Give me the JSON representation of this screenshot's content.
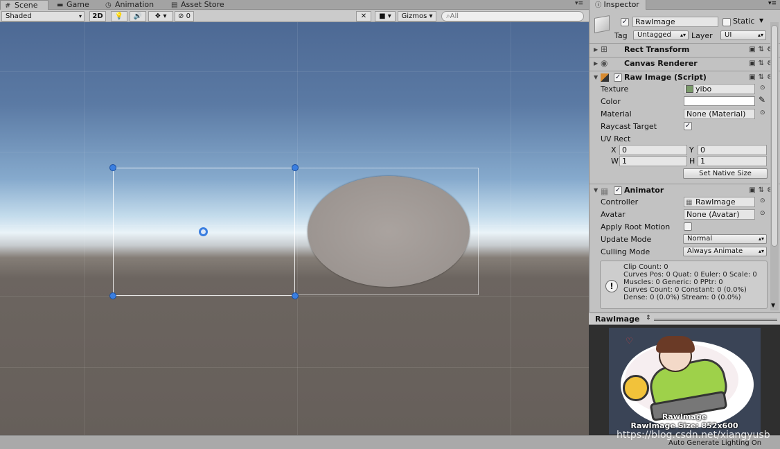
{
  "tabs": [
    {
      "label": "Scene",
      "icon": "grid-icon"
    },
    {
      "label": "Game",
      "icon": "gamepad-icon"
    },
    {
      "label": "Animation",
      "icon": "clock-icon"
    },
    {
      "label": "Asset Store",
      "icon": "store-icon"
    }
  ],
  "toolbar": {
    "shading": "Shaded",
    "mode_2d": "2D",
    "hidden_count": "0",
    "gizmos": "Gizmos",
    "search_placeholder": "All"
  },
  "inspector": {
    "tab": "Inspector",
    "object_name": "RawImage",
    "static_label": "Static",
    "tag_label": "Tag",
    "tag_value": "Untagged",
    "layer_label": "Layer",
    "layer_value": "UI",
    "components": {
      "rect_transform": "Rect Transform",
      "canvas_renderer": "Canvas Renderer",
      "raw_image": "Raw Image (Script)",
      "animator": "Animator"
    },
    "raw_image": {
      "texture_label": "Texture",
      "texture_value": "yibo",
      "color_label": "Color",
      "material_label": "Material",
      "material_value": "None (Material)",
      "raycast_label": "Raycast Target",
      "uv_label": "UV Rect",
      "x_label": "X",
      "x_value": "0",
      "y_label": "Y",
      "y_value": "0",
      "w_label": "W",
      "w_value": "1",
      "h_label": "H",
      "h_value": "1",
      "native_button": "Set Native Size"
    },
    "animator": {
      "controller_label": "Controller",
      "controller_value": "RawImage",
      "avatar_label": "Avatar",
      "avatar_value": "None (Avatar)",
      "root_motion_label": "Apply Root Motion",
      "update_label": "Update Mode",
      "update_value": "Normal",
      "culling_label": "Culling Mode",
      "culling_value": "Always Animate",
      "info": [
        "Clip Count: 0",
        "Curves Pos: 0 Quat: 0 Euler: 0 Scale: 0",
        "Muscles: 0 Generic: 0 PPtr: 0",
        "Curves Count: 0 Constant: 0 (0.0%)",
        "Dense: 0 (0.0%) Stream: 0 (0.0%)"
      ]
    }
  },
  "preview": {
    "title": "RawImage",
    "caption_name": "RawImage",
    "caption_size": "RawImage Size: 852x600"
  },
  "status": {
    "text": "Auto Generate Lighting On",
    "watermark": "https://blog.csdn.net/xiangyusb"
  }
}
